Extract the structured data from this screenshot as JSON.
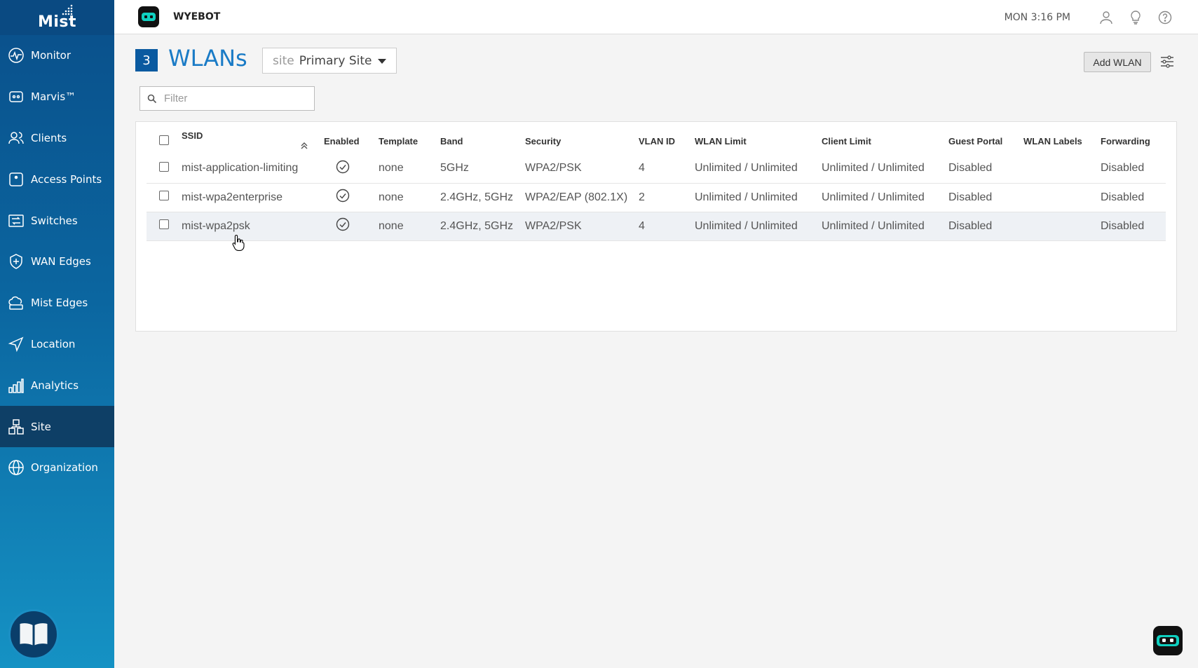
{
  "sidebar": {
    "logo": "Mist",
    "items": [
      {
        "label": "Monitor",
        "icon": "monitor-icon"
      },
      {
        "label": "Marvis™",
        "icon": "marvis-icon"
      },
      {
        "label": "Clients",
        "icon": "clients-icon"
      },
      {
        "label": "Access Points",
        "icon": "access-point-icon"
      },
      {
        "label": "Switches",
        "icon": "switch-icon"
      },
      {
        "label": "WAN Edges",
        "icon": "wan-edge-icon"
      },
      {
        "label": "Mist Edges",
        "icon": "cloud-icon"
      },
      {
        "label": "Location",
        "icon": "location-icon"
      },
      {
        "label": "Analytics",
        "icon": "analytics-icon"
      },
      {
        "label": "Site",
        "icon": "site-icon",
        "active": true
      },
      {
        "label": "Organization",
        "icon": "globe-icon"
      }
    ]
  },
  "topbar": {
    "org_name": "WYEBOT",
    "clock": "MON 3:16 PM"
  },
  "header": {
    "count": "3",
    "title": "WLANs",
    "site_prefix": "site",
    "site_value": "Primary Site",
    "add_button": "Add WLAN"
  },
  "filter": {
    "placeholder": "Filter"
  },
  "table": {
    "columns": [
      "SSID",
      "Enabled",
      "Template",
      "Band",
      "Security",
      "VLAN ID",
      "WLAN Limit",
      "Client Limit",
      "Guest Portal",
      "WLAN Labels",
      "Forwarding"
    ],
    "rows": [
      {
        "ssid": "mist-application-limiting",
        "enabled": true,
        "template": "none",
        "band": "5GHz",
        "security": "WPA2/PSK",
        "vlan": "4",
        "wlan_limit": "Unlimited / Unlimited",
        "client_limit": "Unlimited / Unlimited",
        "guest_portal": "Disabled",
        "labels": "",
        "forwarding": "Disabled"
      },
      {
        "ssid": "mist-wpa2enterprise",
        "enabled": true,
        "template": "none",
        "band": "2.4GHz, 5GHz",
        "security": "WPA2/EAP (802.1X)",
        "vlan": "2",
        "wlan_limit": "Unlimited / Unlimited",
        "client_limit": "Unlimited / Unlimited",
        "guest_portal": "Disabled",
        "labels": "",
        "forwarding": "Disabled"
      },
      {
        "ssid": "mist-wpa2psk",
        "enabled": true,
        "template": "none",
        "band": "2.4GHz, 5GHz",
        "security": "WPA2/PSK",
        "vlan": "4",
        "wlan_limit": "Unlimited / Unlimited",
        "client_limit": "Unlimited / Unlimited",
        "guest_portal": "Disabled",
        "labels": "",
        "forwarding": "Disabled"
      }
    ]
  },
  "colors": {
    "accent": "#1a7bc6",
    "badge": "#0a5aa0",
    "sidebar_active": "#0e3f66"
  }
}
